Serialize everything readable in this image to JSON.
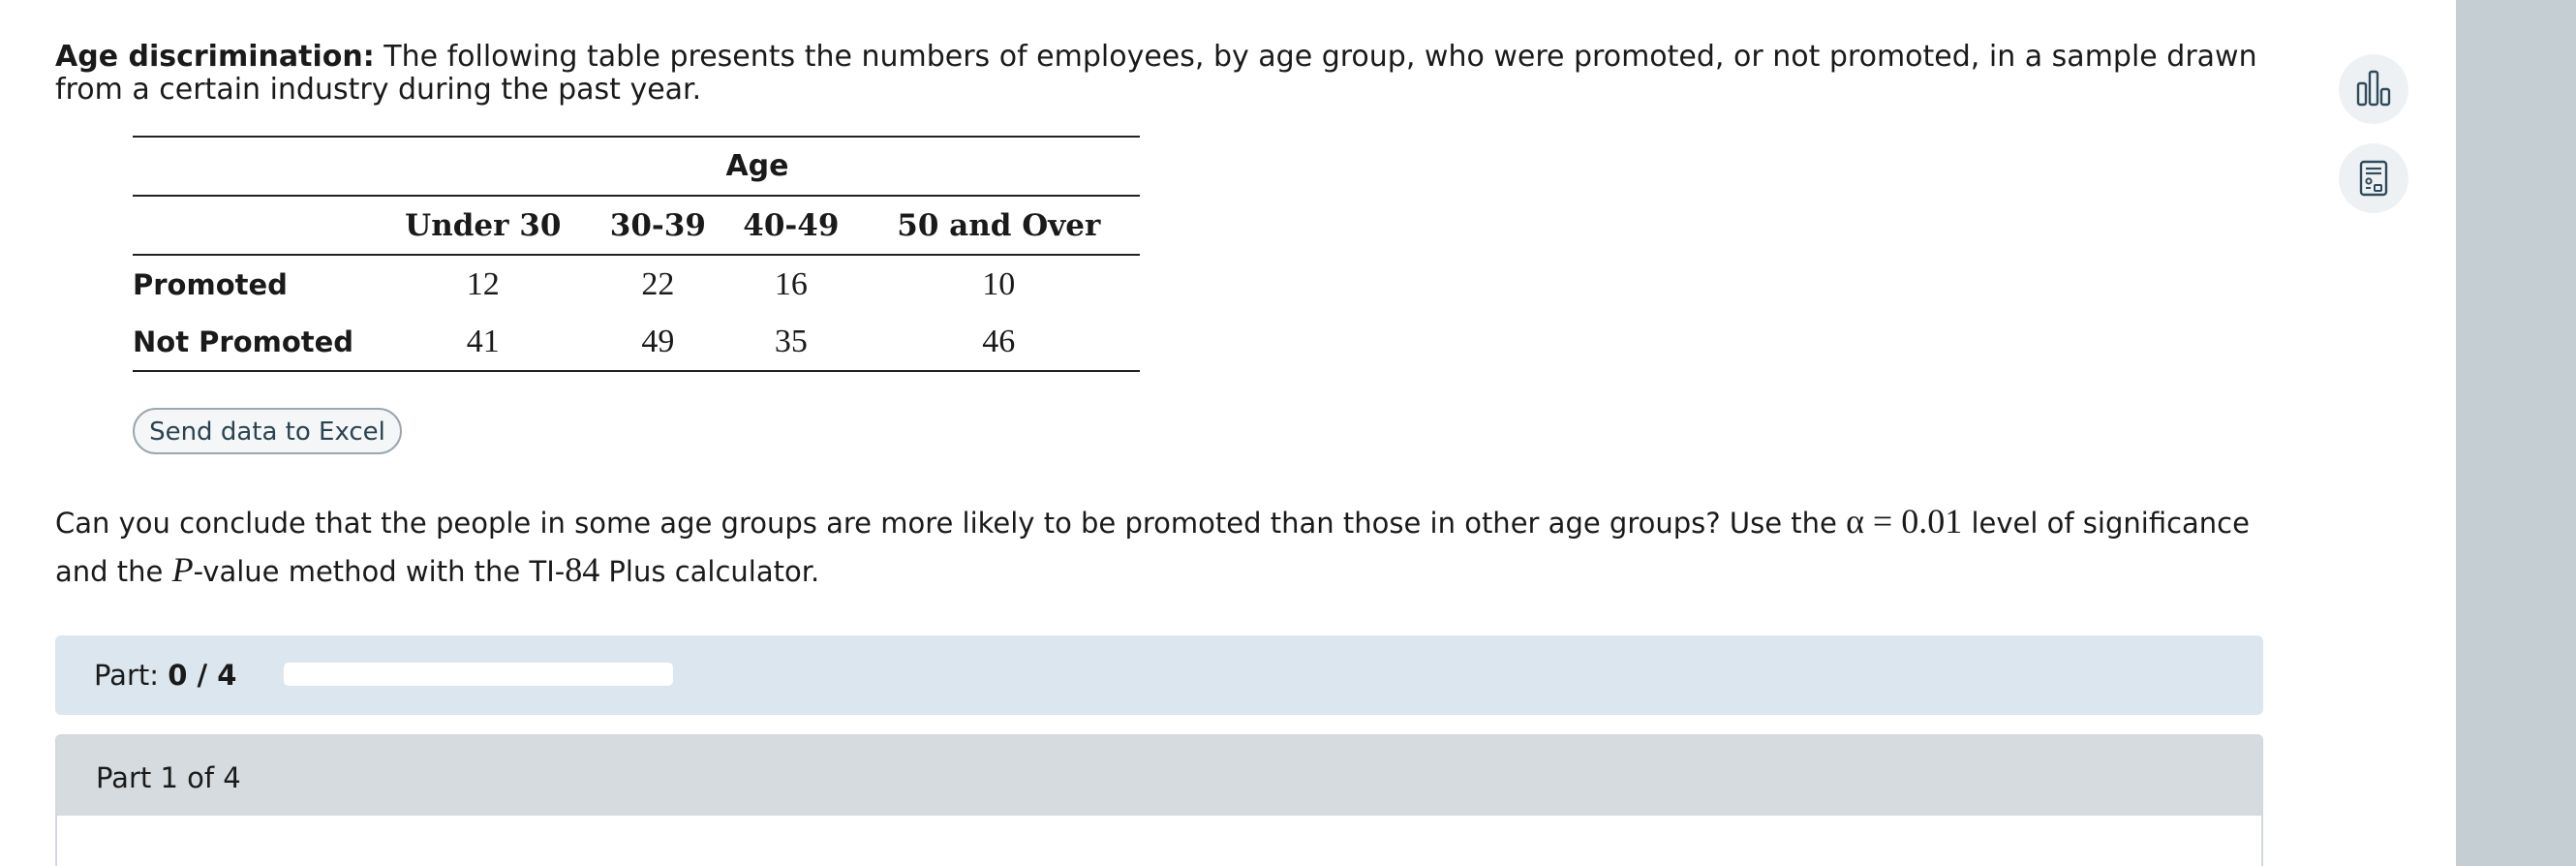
{
  "intro": {
    "label": "Age discrimination:",
    "text": " The following table presents the numbers of employees, by age group, who were promoted, or not promoted, in a sample drawn from a certain industry during the past year."
  },
  "table": {
    "group_header": "Age",
    "columns": [
      "Under 30",
      "30-39",
      "40-49",
      "50 and Over"
    ],
    "rows": [
      {
        "label": "Promoted",
        "values": [
          "12",
          "22",
          "16",
          "10"
        ]
      },
      {
        "label": "Not Promoted",
        "values": [
          "41",
          "49",
          "35",
          "46"
        ]
      }
    ]
  },
  "excel_button": {
    "label": "Send data to Excel"
  },
  "question": {
    "t1": "Can you conclude that the people in some age groups are more likely to be promoted than those in other age groups? Use the ",
    "alpha": "α = 0.01",
    "t2": " level of significance and the ",
    "p": "P",
    "t3": "-value method with the TI-",
    "ti": "84",
    "t4": " Plus calculator."
  },
  "part_progress": {
    "label": "Part:",
    "value": "0 / 4",
    "fraction": 0
  },
  "part_section": {
    "title": "Part 1 of 4"
  },
  "tools": [
    {
      "name": "bar-chart-icon"
    },
    {
      "name": "calculator-icon"
    }
  ]
}
